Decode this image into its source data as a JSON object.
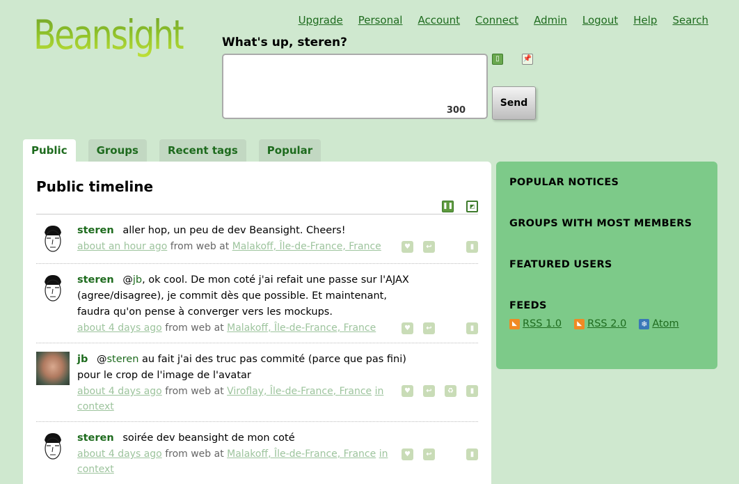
{
  "logo": "Beansight",
  "nav": [
    "Upgrade",
    "Personal",
    "Account",
    "Connect",
    "Admin",
    "Logout",
    "Help",
    "Search"
  ],
  "notice_form": {
    "prompt": "What's up, steren?",
    "counter": "300",
    "send_label": "Send"
  },
  "tabs": [
    "Public",
    "Groups",
    "Recent tags",
    "Popular"
  ],
  "timeline": {
    "title": "Public timeline",
    "notices": [
      {
        "author": "steren",
        "text": "aller hop, un peu de dev Beansight. Cheers!",
        "time": "about an hour ago",
        "from": "from web at",
        "location": "Malakoff, Île-de-France, France",
        "context": ""
      },
      {
        "author": "steren",
        "text_pre": "@",
        "mention": "jb",
        "text": ", ok cool. De mon coté j'ai refait une passe sur l'AJAX (agree/disagree), je commit dès que possible. Et maintenant, faudra qu'on pense à converger vers les mockups.",
        "time": "about 4 days ago",
        "from": "from web at",
        "location": "Malakoff, Île-de-France, France",
        "context": ""
      },
      {
        "author": "jb",
        "text_pre": "@",
        "mention": "steren",
        "text": " au fait j'ai des truc pas commité (parce que pas fini) pour le crop de l'image de l'avatar",
        "time": "about 4 days ago",
        "from": "from web at",
        "location": "Viroflay, Île-de-France, France",
        "context": "in context"
      },
      {
        "author": "steren",
        "text": "soirée dev beansight de mon coté",
        "time": "about 4 days ago",
        "from": "from web at",
        "location": "Malakoff, Île-de-France, France",
        "context": "in context"
      }
    ]
  },
  "sidebar": {
    "popular_notices": "POPULAR NOTICES",
    "groups_most_members": "GROUPS WITH MOST MEMBERS",
    "featured_users": "FEATURED USERS",
    "feeds": "FEEDS",
    "feed_links": [
      "RSS 1.0",
      "RSS 2.0",
      "Atom"
    ]
  },
  "colors": {
    "background": "#cfe8cf",
    "sidebar": "#7dca89",
    "link": "#1e6b1e",
    "meta_link": "#9dc49d"
  }
}
